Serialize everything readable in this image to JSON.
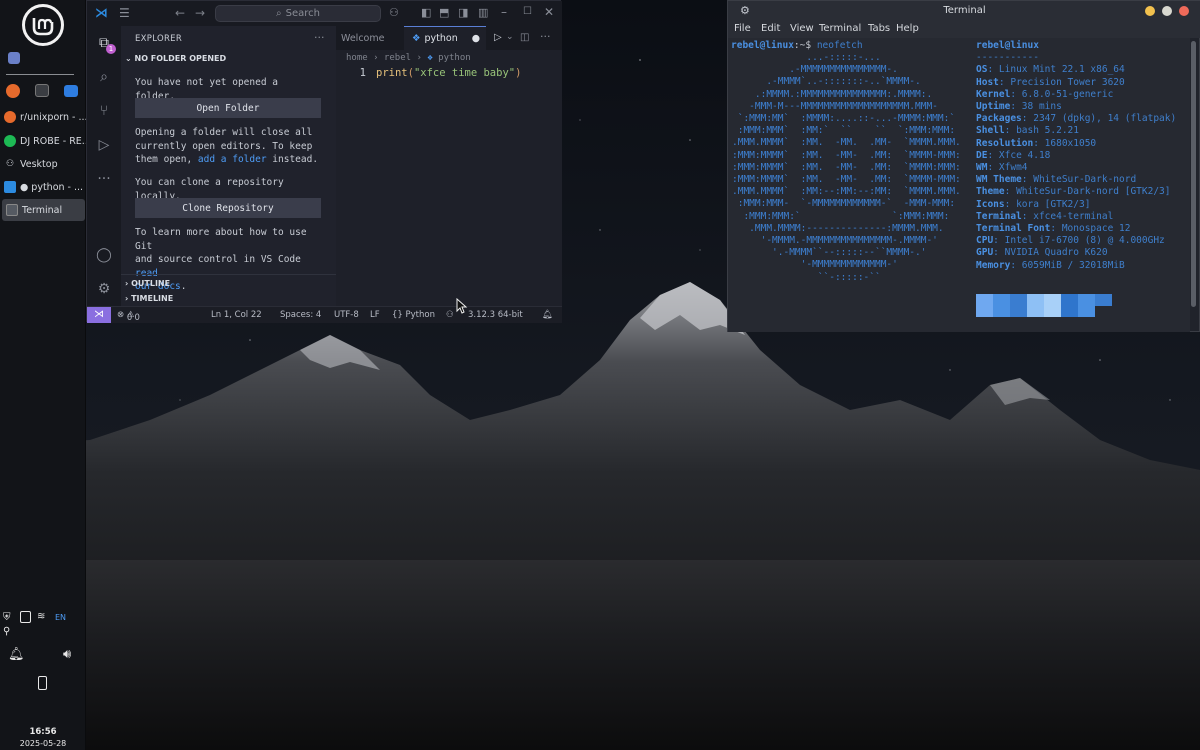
{
  "desktop": {
    "background": "mountain-night"
  },
  "panel": {
    "logo": "linux-mint-logo",
    "launchers": [
      {
        "name": "firefox-icon",
        "color": "#e66a2c"
      },
      {
        "name": "terminal-launcher-icon",
        "color": "#3a3d42"
      },
      {
        "name": "files-icon",
        "color": "#2e7de0"
      }
    ],
    "tasks": [
      {
        "label": "r/unixporn - ...",
        "icon": "firefox-icon",
        "color": "#e66a2c",
        "active": false
      },
      {
        "label": "DJ ROBE - RE...",
        "icon": "spotify-icon",
        "color": "#1db954",
        "active": false
      },
      {
        "label": "Vesktop",
        "icon": "vesktop-icon",
        "color": "#8a8d92",
        "active": false
      },
      {
        "label": "● python - ...",
        "icon": "vscode-icon",
        "color": "#2c8be0",
        "active": false
      },
      {
        "label": "Terminal",
        "icon": "terminal-icon",
        "color": "#555a62",
        "active": true
      }
    ],
    "tray": {
      "keyboard_layout": "EN"
    },
    "clock": {
      "time": "16:56",
      "date": "2025-05-28"
    }
  },
  "vscode": {
    "search_placeholder": "Search",
    "explorer_title": "EXPLORER",
    "no_folder": "NO FOLDER OPENED",
    "msg1": "You have not yet opened a folder.",
    "open_folder": "Open Folder",
    "msg2a": "Opening a folder will close all",
    "msg2b": "currently open editors. To keep",
    "msg2c": "them open, ",
    "msg2_link": "add a folder",
    "msg2d": " instead.",
    "msg3": "You can clone a repository locally.",
    "clone": "Clone Repository",
    "msg4a": "To learn more about how to use Git",
    "msg4b": "and source control in VS Code ",
    "msg4_link1": "read",
    "msg4_link2": "our docs",
    "msg4_end": ".",
    "outline": "OUTLINE",
    "timeline": "TIMELINE",
    "badge": "1",
    "tabs": [
      {
        "label": "Welcome"
      },
      {
        "label": "python"
      }
    ],
    "breadcrumb": [
      "home",
      "rebel",
      "python"
    ],
    "code": {
      "line_no": "1",
      "fn": "print",
      "open": "(",
      "str": "\"xfce time baby\"",
      "close": ")"
    },
    "status": {
      "errors": "0",
      "warnings": "0",
      "position": "Ln 1, Col 22",
      "spaces": "Spaces: 4",
      "encoding": "UTF-8",
      "eol": "LF",
      "language": "{} Python",
      "interpreter": "3.12.3 64-bit"
    }
  },
  "terminal": {
    "title": "Terminal",
    "menu": [
      "File",
      "Edit",
      "View",
      "Terminal",
      "Tabs",
      "Help"
    ],
    "prompt_user": "rebel@linux",
    "prompt_path": ":~$ ",
    "command": "neofetch",
    "header": "rebel@linux",
    "separator": "-----------",
    "info": [
      {
        "k": "OS",
        "v": "Linux Mint 22.1 x86_64"
      },
      {
        "k": "Host",
        "v": "Precision Tower 3620"
      },
      {
        "k": "Kernel",
        "v": "6.8.0-51-generic"
      },
      {
        "k": "Uptime",
        "v": "38 mins"
      },
      {
        "k": "Packages",
        "v": "2347 (dpkg), 14 (flatpak)"
      },
      {
        "k": "Shell",
        "v": "bash 5.2.21"
      },
      {
        "k": "Resolution",
        "v": "1680x1050"
      },
      {
        "k": "DE",
        "v": "Xfce 4.18"
      },
      {
        "k": "WM",
        "v": "Xfwm4"
      },
      {
        "k": "WM Theme",
        "v": "WhiteSur-Dark-nord"
      },
      {
        "k": "Theme",
        "v": "WhiteSur-Dark-nord [GTK2/3]"
      },
      {
        "k": "Icons",
        "v": "kora [GTK2/3]"
      },
      {
        "k": "Terminal",
        "v": "xfce4-terminal"
      },
      {
        "k": "Terminal Font",
        "v": "Monospace 12"
      },
      {
        "k": "CPU",
        "v": "Intel i7-6700 (8) @ 4.000GHz"
      },
      {
        "k": "GPU",
        "v": "NVIDIA Quadro K620"
      },
      {
        "k": "Memory",
        "v": "6059MiB / 32018MiB"
      }
    ],
    "ascii": [
      "             ...-:::::-...",
      "          .-MMMMMMMMMMMMMMM-.",
      "      .-MMMM`..-:::::::-..`MMMM-.",
      "    .:MMMM.:MMMMMMMMMMMMMMM:.MMMM:.",
      "   -MMM-M---MMMMMMMMMMMMMMMMMMM.MMM-",
      " `:MMM:MM`  :MMMM:....::-...-MMMM:MMM:`",
      " :MMM:MMM`  :MM:`  ``    ``  `:MMM:MMM:",
      ".MMM.MMMM`  :MM.  -MM.  .MM-  `MMMM.MMM.",
      ":MMM:MMMM`  :MM.  -MM-  .MM:  `MMMM-MMM:",
      ":MMM:MMMM`  :MM.  -MM-  .MM:  `MMMM:MMM:",
      ":MMM:MMMM`  :MM.  -MM-  .MM:  `MMMM-MMM:",
      ".MMM.MMMM`  :MM:--:MM:--:MM:  `MMMM.MMM.",
      " :MMM:MMM-  `-MMMMMMMMMMMM-`  -MMM-MMM:",
      "  :MMM:MMM:`                `:MMM:MMM:",
      "   .MMM.MMMM:--------------:MMMM.MMM.",
      "     '-MMMM.-MMMMMMMMMMMMMMM-.MMMM-'",
      "       '.-MMMM``--:::::--``MMMM-.'",
      "            '-MMMMMMMMMMMMM-'",
      "               ``-:::::-``"
    ],
    "palette": [
      "#6fa8f0",
      "#4a90e2",
      "#3a7dd0",
      "#8ec0f5",
      "#a8d0f8",
      "#2f75cc",
      "#4a90e2",
      "#3a7dd0"
    ]
  }
}
